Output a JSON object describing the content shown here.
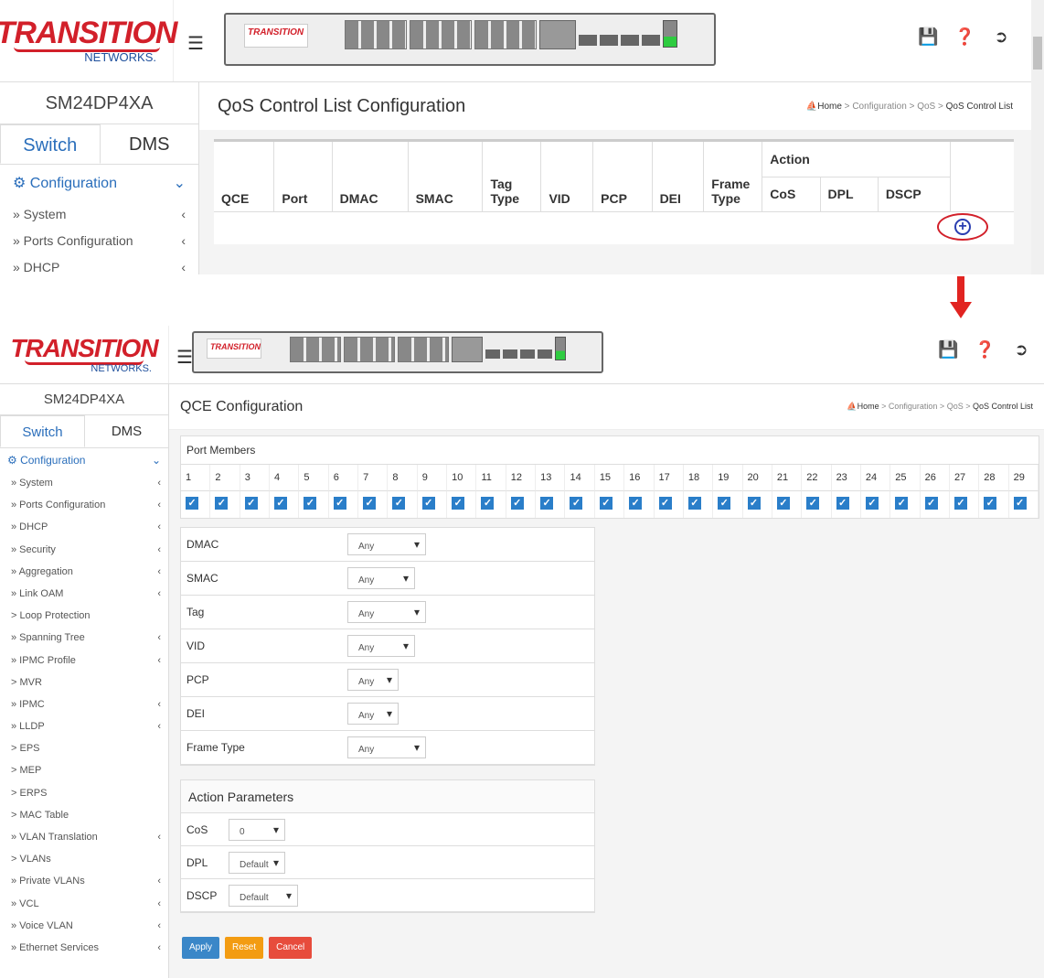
{
  "brand": {
    "line1": "TRANSITION",
    "line2": "NETWORKS."
  },
  "device_name": "SM24DP4XA",
  "tabs": {
    "switch": "Switch",
    "dms": "DMS"
  },
  "config_label": "Configuration",
  "panel_logo": "TRANSITION",
  "shot1": {
    "sidebar_items": [
      "» System",
      "» Ports Configuration",
      "» DHCP"
    ],
    "title": "QoS Control List Configuration",
    "breadcrumb": {
      "home": "Home",
      "sep1": " > ",
      "c1": "Configuration",
      "sep2": " > ",
      "c2": "QoS",
      "sep3": " > ",
      "c3": "QoS Control List"
    },
    "columns": [
      "QCE",
      "Port",
      "DMAC",
      "SMAC",
      "Tag Type",
      "VID",
      "PCP",
      "DEI",
      "Frame Type"
    ],
    "action_header": "Action",
    "action_columns": [
      "CoS",
      "DPL",
      "DSCP"
    ]
  },
  "shot2": {
    "sidebar_items": [
      {
        "label": "» System",
        "chev": true
      },
      {
        "label": "» Ports Configuration",
        "chev": true
      },
      {
        "label": "» DHCP",
        "chev": true
      },
      {
        "label": "» Security",
        "chev": true
      },
      {
        "label": "» Aggregation",
        "chev": true
      },
      {
        "label": "» Link OAM",
        "chev": true
      },
      {
        "label": "> Loop Protection",
        "chev": false
      },
      {
        "label": "» Spanning Tree",
        "chev": true
      },
      {
        "label": "» IPMC Profile",
        "chev": true
      },
      {
        "label": "> MVR",
        "chev": false
      },
      {
        "label": "» IPMC",
        "chev": true
      },
      {
        "label": "» LLDP",
        "chev": true
      },
      {
        "label": "> EPS",
        "chev": false
      },
      {
        "label": "> MEP",
        "chev": false
      },
      {
        "label": "> ERPS",
        "chev": false
      },
      {
        "label": "> MAC Table",
        "chev": false
      },
      {
        "label": "» VLAN Translation",
        "chev": true
      },
      {
        "label": "> VLANs",
        "chev": false
      },
      {
        "label": "» Private VLANs",
        "chev": true
      },
      {
        "label": "» VCL",
        "chev": true
      },
      {
        "label": "» Voice VLAN",
        "chev": true
      },
      {
        "label": "» Ethernet Services",
        "chev": true
      }
    ],
    "title": "QCE Configuration",
    "breadcrumb": {
      "home": "Home",
      "sep1": " > ",
      "c1": "Configuration",
      "sep2": " > ",
      "c2": "QoS",
      "sep3": " > ",
      "c3": "QoS Control List"
    },
    "port_members_label": "Port Members",
    "ports": [
      "1",
      "2",
      "3",
      "4",
      "5",
      "6",
      "7",
      "8",
      "9",
      "10",
      "11",
      "12",
      "13",
      "14",
      "15",
      "16",
      "17",
      "18",
      "19",
      "20",
      "21",
      "22",
      "23",
      "24",
      "25",
      "26",
      "27",
      "28",
      "29"
    ],
    "fields": [
      {
        "label": "DMAC",
        "value": "Any",
        "width": 86
      },
      {
        "label": "SMAC",
        "value": "Any",
        "width": 74
      },
      {
        "label": "Tag",
        "value": "Any",
        "width": 86
      },
      {
        "label": "VID",
        "value": "Any",
        "width": 74
      },
      {
        "label": "PCP",
        "value": "Any",
        "width": 56
      },
      {
        "label": "DEI",
        "value": "Any",
        "width": 56
      },
      {
        "label": "Frame Type",
        "value": "Any",
        "width": 86
      }
    ],
    "action_title": "Action Parameters",
    "actions": [
      {
        "label": "CoS",
        "value": "0",
        "width": 62
      },
      {
        "label": "DPL",
        "value": "Default",
        "width": 62
      },
      {
        "label": "DSCP",
        "value": "Default",
        "width": 76
      }
    ],
    "buttons": {
      "apply": "Apply",
      "reset": "Reset",
      "cancel": "Cancel"
    }
  }
}
